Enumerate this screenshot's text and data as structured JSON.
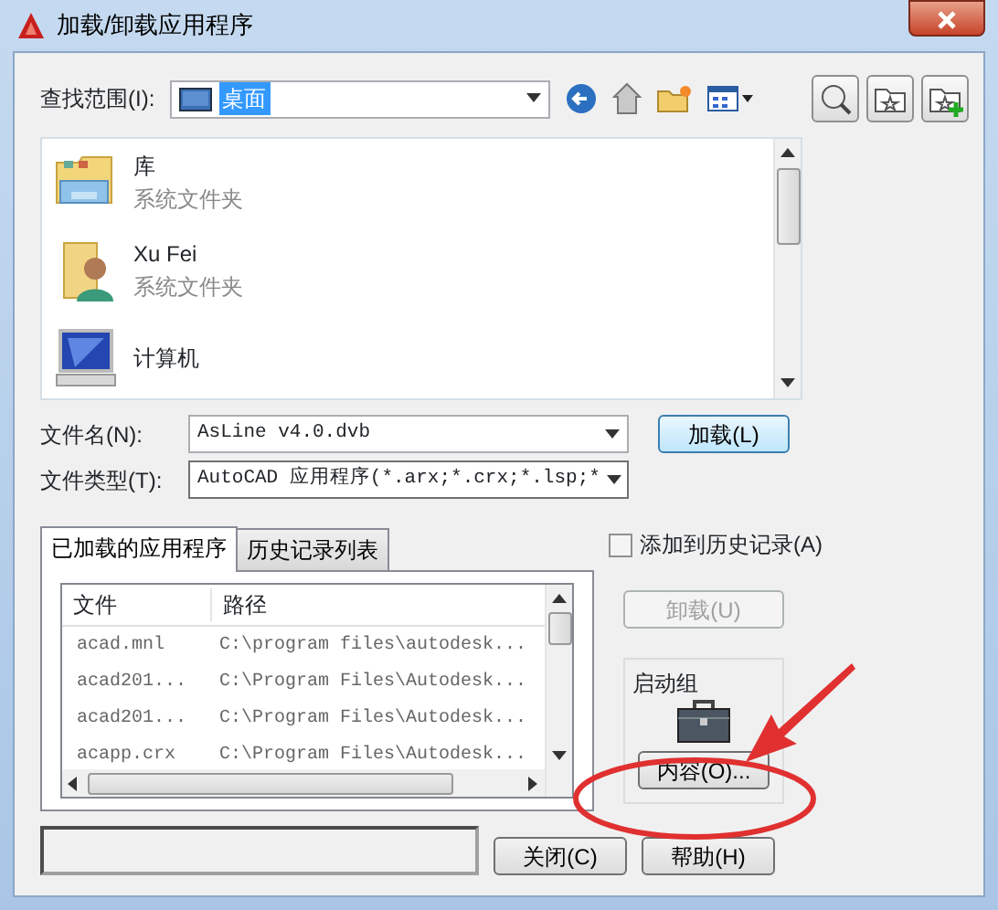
{
  "window": {
    "title": "加载/卸载应用程序"
  },
  "look_in": {
    "label": "查找范围(I):",
    "value": "桌面"
  },
  "files": [
    {
      "name": "库",
      "subtitle": "系统文件夹",
      "kind": "library"
    },
    {
      "name": "Xu Fei",
      "subtitle": "系统文件夹",
      "kind": "user"
    },
    {
      "name": "计算机",
      "kind": "computer"
    }
  ],
  "file_name": {
    "label": "文件名(N):",
    "value": "AsLine v4.0.dvb"
  },
  "load_button": "加载(L)",
  "file_type": {
    "label": "文件类型(T):",
    "value": "AutoCAD 应用程序(*.arx;*.crx;*.lsp;*"
  },
  "tabs": [
    {
      "label": "已加载的应用程序",
      "selected": true
    },
    {
      "label": "历史记录列表",
      "selected": false
    }
  ],
  "table": {
    "columns": [
      "文件",
      "路径"
    ],
    "rows": [
      [
        "acad.mnl",
        "C:\\program files\\autodesk..."
      ],
      [
        "acad201...",
        "C:\\Program Files\\Autodesk..."
      ],
      [
        "acad201...",
        "C:\\Program Files\\Autodesk..."
      ],
      [
        "acapp.crx",
        "C:\\Program Files\\Autodesk..."
      ]
    ]
  },
  "add_to_history": {
    "label": "添加到历史记录(A)",
    "checked": false
  },
  "unload_button": {
    "label": "卸载(U)",
    "disabled": true
  },
  "startup_suite": {
    "title": "启动组",
    "contents_button": "内容(O)..."
  },
  "buttons": [
    "关闭(C)",
    "帮助(H)"
  ]
}
